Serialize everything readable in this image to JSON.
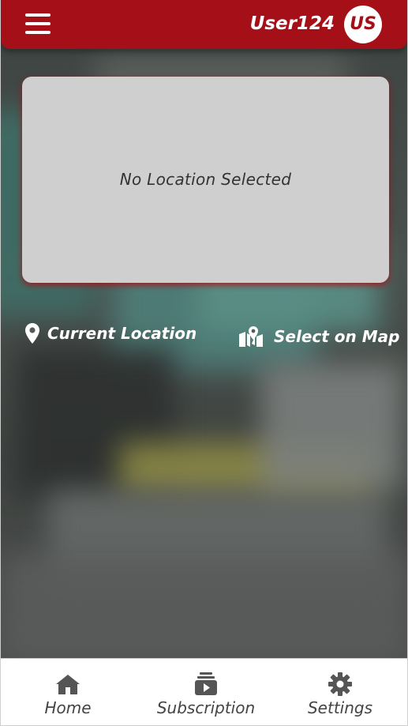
{
  "header": {
    "username": "User124",
    "avatar_initials": "US",
    "menu_icon": "hamburger-menu-icon"
  },
  "location_card": {
    "message": "No Location Selected"
  },
  "actions": {
    "current_location": {
      "label": "Current Location",
      "icon": "map-pin-icon"
    },
    "select_on_map": {
      "label": "Select on Map",
      "icon": "map-location-icon"
    }
  },
  "bottom_nav": {
    "items": [
      {
        "label": "Home",
        "icon": "home-icon"
      },
      {
        "label": "Subscription",
        "icon": "subscription-icon"
      },
      {
        "label": "Settings",
        "icon": "gear-icon"
      }
    ]
  },
  "colors": {
    "brand": "#a50f17",
    "card": "#cfcfcf",
    "nav_text": "#444444"
  }
}
